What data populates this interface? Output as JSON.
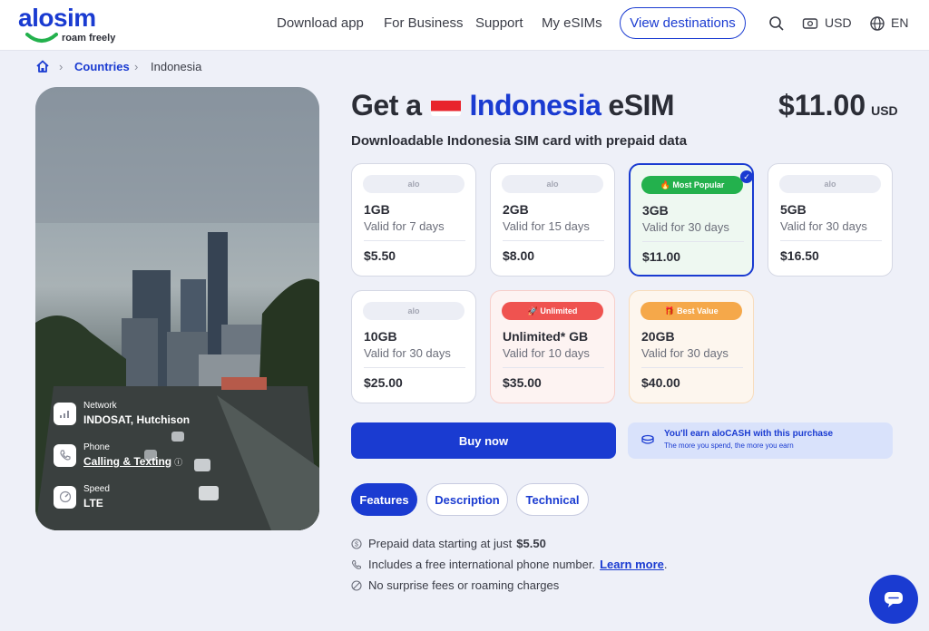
{
  "brand": {
    "logo": "alosim",
    "tagline": "roam freely"
  },
  "nav": {
    "download": "Download app",
    "business": "For Business",
    "support": "Support",
    "esims": "My eSIMs",
    "destinations": "View destinations",
    "currency": "USD",
    "language": "EN"
  },
  "breadcrumb": {
    "countries": "Countries",
    "current": "Indonesia"
  },
  "network": {
    "network_label": "Network",
    "network_value": "INDOSAT, Hutchison",
    "phone_label": "Phone",
    "phone_value": "Calling & Texting",
    "speed_label": "Speed",
    "speed_value": "LTE"
  },
  "product": {
    "title_prefix": "Get a",
    "country": "Indonesia",
    "title_suffix": "eSIM",
    "price": "$11.00",
    "price_currency": "USD",
    "subtitle": "Downloadable Indonesia SIM card with prepaid data"
  },
  "plans": [
    {
      "badge": "alo",
      "data": "1GB",
      "valid": "Valid for 7 days",
      "price": "$5.50"
    },
    {
      "badge": "alo",
      "data": "2GB",
      "valid": "Valid for 15 days",
      "price": "$8.00"
    },
    {
      "badge": "🔥 Most Popular",
      "data": "3GB",
      "valid": "Valid for 30 days",
      "price": "$11.00",
      "selected": true
    },
    {
      "badge": "alo",
      "data": "5GB",
      "valid": "Valid for 30 days",
      "price": "$16.50"
    },
    {
      "badge": "alo",
      "data": "10GB",
      "valid": "Valid for 30 days",
      "price": "$25.00"
    },
    {
      "badge": "🚀 Unlimited",
      "data": "Unlimited* GB",
      "valid": "Valid for 10 days",
      "price": "$35.00"
    },
    {
      "badge": "🎁 Best Value",
      "data": "20GB",
      "valid": "Valid for 30 days",
      "price": "$40.00"
    }
  ],
  "actions": {
    "buy": "Buy now",
    "earn_title": "You'll earn aloCASH with this purchase",
    "earn_sub": "The more you spend, the more you earn"
  },
  "tabs": {
    "features": "Features",
    "description": "Description",
    "technical": "Technical"
  },
  "features": {
    "f1_text": "Prepaid data starting at just",
    "f1_price": "$5.50",
    "f2_text": "Includes a free international phone number.",
    "f2_link": "Learn more",
    "f2_end": ".",
    "f3_text": "No surprise fees or roaming charges"
  },
  "colors": {
    "accent": "#1a3bd1",
    "popular": "#23b14d",
    "unlimited": "#ef5350",
    "best": "#f5a84a"
  }
}
